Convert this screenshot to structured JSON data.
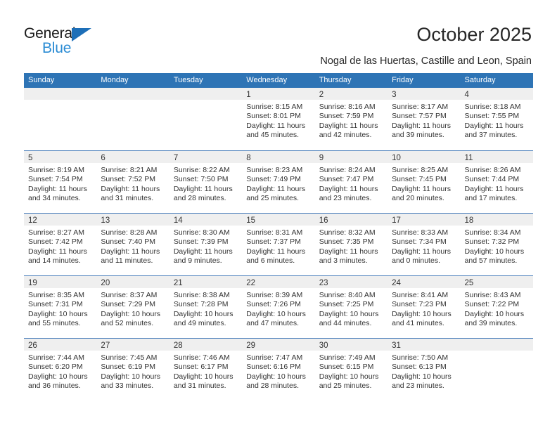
{
  "brand": {
    "name_part1": "General",
    "name_part2": "Blue",
    "accent_color": "#2b8cd4",
    "triangle_color": "#1d6fb8"
  },
  "header": {
    "title": "October 2025",
    "subtitle": "Nogal de las Huertas, Castille and Leon, Spain"
  },
  "calendar": {
    "header_bg": "#2e74b5",
    "daynumber_bg": "#efefef",
    "row_divider_color": "#4a7ebb",
    "weekdays": [
      "Sunday",
      "Monday",
      "Tuesday",
      "Wednesday",
      "Thursday",
      "Friday",
      "Saturday"
    ],
    "weeks": [
      [
        {
          "day": "",
          "lines": []
        },
        {
          "day": "",
          "lines": []
        },
        {
          "day": "",
          "lines": []
        },
        {
          "day": "1",
          "lines": [
            "Sunrise: 8:15 AM",
            "Sunset: 8:01 PM",
            "Daylight: 11 hours",
            "and 45 minutes."
          ]
        },
        {
          "day": "2",
          "lines": [
            "Sunrise: 8:16 AM",
            "Sunset: 7:59 PM",
            "Daylight: 11 hours",
            "and 42 minutes."
          ]
        },
        {
          "day": "3",
          "lines": [
            "Sunrise: 8:17 AM",
            "Sunset: 7:57 PM",
            "Daylight: 11 hours",
            "and 39 minutes."
          ]
        },
        {
          "day": "4",
          "lines": [
            "Sunrise: 8:18 AM",
            "Sunset: 7:55 PM",
            "Daylight: 11 hours",
            "and 37 minutes."
          ]
        }
      ],
      [
        {
          "day": "5",
          "lines": [
            "Sunrise: 8:19 AM",
            "Sunset: 7:54 PM",
            "Daylight: 11 hours",
            "and 34 minutes."
          ]
        },
        {
          "day": "6",
          "lines": [
            "Sunrise: 8:21 AM",
            "Sunset: 7:52 PM",
            "Daylight: 11 hours",
            "and 31 minutes."
          ]
        },
        {
          "day": "7",
          "lines": [
            "Sunrise: 8:22 AM",
            "Sunset: 7:50 PM",
            "Daylight: 11 hours",
            "and 28 minutes."
          ]
        },
        {
          "day": "8",
          "lines": [
            "Sunrise: 8:23 AM",
            "Sunset: 7:49 PM",
            "Daylight: 11 hours",
            "and 25 minutes."
          ]
        },
        {
          "day": "9",
          "lines": [
            "Sunrise: 8:24 AM",
            "Sunset: 7:47 PM",
            "Daylight: 11 hours",
            "and 23 minutes."
          ]
        },
        {
          "day": "10",
          "lines": [
            "Sunrise: 8:25 AM",
            "Sunset: 7:45 PM",
            "Daylight: 11 hours",
            "and 20 minutes."
          ]
        },
        {
          "day": "11",
          "lines": [
            "Sunrise: 8:26 AM",
            "Sunset: 7:44 PM",
            "Daylight: 11 hours",
            "and 17 minutes."
          ]
        }
      ],
      [
        {
          "day": "12",
          "lines": [
            "Sunrise: 8:27 AM",
            "Sunset: 7:42 PM",
            "Daylight: 11 hours",
            "and 14 minutes."
          ]
        },
        {
          "day": "13",
          "lines": [
            "Sunrise: 8:28 AM",
            "Sunset: 7:40 PM",
            "Daylight: 11 hours",
            "and 11 minutes."
          ]
        },
        {
          "day": "14",
          "lines": [
            "Sunrise: 8:30 AM",
            "Sunset: 7:39 PM",
            "Daylight: 11 hours",
            "and 9 minutes."
          ]
        },
        {
          "day": "15",
          "lines": [
            "Sunrise: 8:31 AM",
            "Sunset: 7:37 PM",
            "Daylight: 11 hours",
            "and 6 minutes."
          ]
        },
        {
          "day": "16",
          "lines": [
            "Sunrise: 8:32 AM",
            "Sunset: 7:35 PM",
            "Daylight: 11 hours",
            "and 3 minutes."
          ]
        },
        {
          "day": "17",
          "lines": [
            "Sunrise: 8:33 AM",
            "Sunset: 7:34 PM",
            "Daylight: 11 hours",
            "and 0 minutes."
          ]
        },
        {
          "day": "18",
          "lines": [
            "Sunrise: 8:34 AM",
            "Sunset: 7:32 PM",
            "Daylight: 10 hours",
            "and 57 minutes."
          ]
        }
      ],
      [
        {
          "day": "19",
          "lines": [
            "Sunrise: 8:35 AM",
            "Sunset: 7:31 PM",
            "Daylight: 10 hours",
            "and 55 minutes."
          ]
        },
        {
          "day": "20",
          "lines": [
            "Sunrise: 8:37 AM",
            "Sunset: 7:29 PM",
            "Daylight: 10 hours",
            "and 52 minutes."
          ]
        },
        {
          "day": "21",
          "lines": [
            "Sunrise: 8:38 AM",
            "Sunset: 7:28 PM",
            "Daylight: 10 hours",
            "and 49 minutes."
          ]
        },
        {
          "day": "22",
          "lines": [
            "Sunrise: 8:39 AM",
            "Sunset: 7:26 PM",
            "Daylight: 10 hours",
            "and 47 minutes."
          ]
        },
        {
          "day": "23",
          "lines": [
            "Sunrise: 8:40 AM",
            "Sunset: 7:25 PM",
            "Daylight: 10 hours",
            "and 44 minutes."
          ]
        },
        {
          "day": "24",
          "lines": [
            "Sunrise: 8:41 AM",
            "Sunset: 7:23 PM",
            "Daylight: 10 hours",
            "and 41 minutes."
          ]
        },
        {
          "day": "25",
          "lines": [
            "Sunrise: 8:43 AM",
            "Sunset: 7:22 PM",
            "Daylight: 10 hours",
            "and 39 minutes."
          ]
        }
      ],
      [
        {
          "day": "26",
          "lines": [
            "Sunrise: 7:44 AM",
            "Sunset: 6:20 PM",
            "Daylight: 10 hours",
            "and 36 minutes."
          ]
        },
        {
          "day": "27",
          "lines": [
            "Sunrise: 7:45 AM",
            "Sunset: 6:19 PM",
            "Daylight: 10 hours",
            "and 33 minutes."
          ]
        },
        {
          "day": "28",
          "lines": [
            "Sunrise: 7:46 AM",
            "Sunset: 6:17 PM",
            "Daylight: 10 hours",
            "and 31 minutes."
          ]
        },
        {
          "day": "29",
          "lines": [
            "Sunrise: 7:47 AM",
            "Sunset: 6:16 PM",
            "Daylight: 10 hours",
            "and 28 minutes."
          ]
        },
        {
          "day": "30",
          "lines": [
            "Sunrise: 7:49 AM",
            "Sunset: 6:15 PM",
            "Daylight: 10 hours",
            "and 25 minutes."
          ]
        },
        {
          "day": "31",
          "lines": [
            "Sunrise: 7:50 AM",
            "Sunset: 6:13 PM",
            "Daylight: 10 hours",
            "and 23 minutes."
          ]
        },
        {
          "day": "",
          "lines": []
        }
      ]
    ]
  }
}
